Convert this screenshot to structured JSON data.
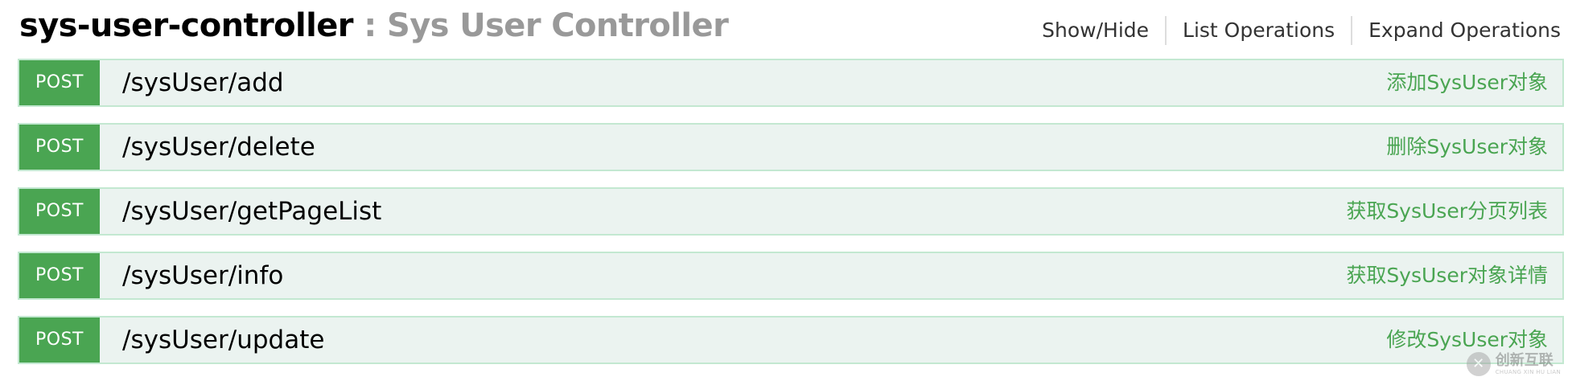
{
  "header": {
    "name": "sys-user-controller",
    "separator": " : ",
    "description": "Sys User Controller",
    "links": {
      "show_hide": "Show/Hide",
      "list_operations": "List Operations",
      "expand_operations": "Expand Operations"
    }
  },
  "operations": [
    {
      "method": "POST",
      "path": "/sysUser/add",
      "summary": "添加SysUser对象"
    },
    {
      "method": "POST",
      "path": "/sysUser/delete",
      "summary": "删除SysUser对象"
    },
    {
      "method": "POST",
      "path": "/sysUser/getPageList",
      "summary": "获取SysUser分页列表"
    },
    {
      "method": "POST",
      "path": "/sysUser/info",
      "summary": "获取SysUser对象详情"
    },
    {
      "method": "POST",
      "path": "/sysUser/update",
      "summary": "修改SysUser对象"
    }
  ],
  "watermark": {
    "brand_cn": "创新互联",
    "brand_en": "CHUANG XIN HU LIAN"
  },
  "colors": {
    "post_badge": "#4aa552",
    "row_background": "#ebf3f0",
    "row_border": "#c3e8d1",
    "summary_text": "#4aa552",
    "description_text": "#999999"
  }
}
